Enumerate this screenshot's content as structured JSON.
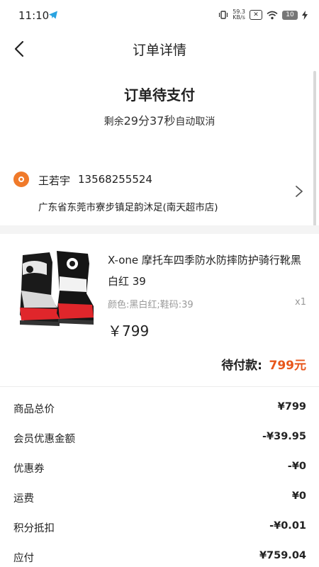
{
  "status_bar": {
    "time": "11:10",
    "net_speed_top": "59.3",
    "net_speed_bottom": "KB/s",
    "battery": "10"
  },
  "header": {
    "title": "订单详情"
  },
  "order_status": {
    "title": "订单待支付",
    "countdown_prefix": "剩余",
    "minutes": "29",
    "minutes_unit": "分",
    "seconds": "37",
    "seconds_unit": "秒",
    "countdown_suffix": "自动取消"
  },
  "address": {
    "name": "王若宇",
    "phone": "13568255524",
    "detail": "广东省东莞市寮步镇足韵沐足(南天超市店)"
  },
  "product": {
    "name": "X-one 摩托车四季防水防摔防护骑行靴黑白红 39",
    "spec": "颜色:黑白红;鞋码:39",
    "quantity": "x1",
    "price": "￥799",
    "pending_label": "待付款:",
    "pending_value": "799元"
  },
  "fees": [
    {
      "label": "商品总价",
      "value": "¥799"
    },
    {
      "label": "会员优惠金额",
      "value": "-¥39.95"
    },
    {
      "label": "优惠券",
      "value": "-¥0"
    },
    {
      "label": "运费",
      "value": "¥0"
    },
    {
      "label": "积分抵扣",
      "value": "-¥0.01"
    },
    {
      "label": "应付",
      "value": "¥759.04"
    }
  ],
  "colors": {
    "accent": "#e8561b",
    "location_icon": "#f07a2a"
  }
}
